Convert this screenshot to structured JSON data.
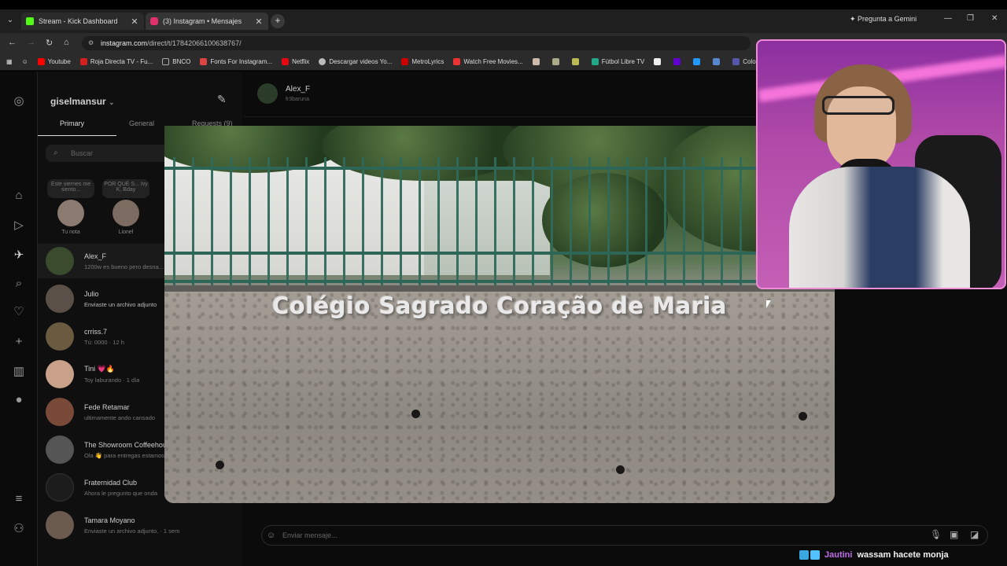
{
  "browser": {
    "tabs": [
      {
        "label": "Stream - Kick Dashboard",
        "color": "#53fc18"
      },
      {
        "label": "(3) Instagram • Mensajes",
        "color": "#e1306c"
      }
    ],
    "gemini": "Pregunta a Gemini",
    "url_host": "instagram.com",
    "url_path": "/direct/t/17842066100638767/",
    "bookmarks": [
      {
        "label": "Youtube",
        "color": "#ff0000"
      },
      {
        "label": "Roja Directa TV - Fu...",
        "color": "#d42020"
      },
      {
        "label": "BNCO",
        "color": "#888888"
      },
      {
        "label": "Fonts For Instagram...",
        "color": "#d44"
      },
      {
        "label": "Netflix",
        "color": "#e50914"
      },
      {
        "label": "Descargar videos Yo...",
        "color": "#bbb"
      },
      {
        "label": "MetroLyrics",
        "color": "#c00"
      },
      {
        "label": "Watch Free Movies...",
        "color": "#e33"
      },
      {
        "label": "Fútbol Libre TV",
        "color": "#2a8"
      },
      {
        "label": "Colossal",
        "color": "#55a"
      }
    ]
  },
  "instagram": {
    "username": "giselmansur",
    "tabs": [
      "Primary",
      "General",
      "Requests (9)"
    ],
    "search_placeholder": "Buscar",
    "notes": [
      {
        "bubble": "Este viernes me siento...",
        "name": "Tu nota"
      },
      {
        "bubble": "POR QUÉ S... Ivy K, Bday",
        "name": "Lionel"
      }
    ],
    "conversations": [
      {
        "name": "Alex_F",
        "preview": "1200w es bueno pero desna...",
        "color": "#3b4c2e"
      },
      {
        "name": "Julio",
        "preview": "Enviaste un archivo adjunto",
        "color": "#5a5048"
      },
      {
        "name": "crriss.7",
        "preview": "Tú: 0000 · 12 h",
        "color": "#6a5a40"
      },
      {
        "name": "Tini 💗🔥",
        "preview": "Toy laburando · 1 día",
        "color": "#c9a08a"
      },
      {
        "name": "Fede Retamar",
        "preview": "ultimamente ando cansado",
        "color": "#7a4a38"
      },
      {
        "name": "The Showroom Coffeehouse",
        "preview": "Ola 👋 para entregas estamos",
        "color": "#555"
      },
      {
        "name": "Fraternidad Club",
        "preview": "Ahora le pregunto que onda",
        "color": "#222"
      },
      {
        "name": "Tamara Moyano",
        "preview": "Enviaste un archivo adjunto. · 1 sem",
        "color": "#6b5a4e"
      }
    ],
    "chat": {
      "name": "Alex_F",
      "sub": "fr3baruna"
    },
    "message_placeholder": "Enviar mensaje..."
  },
  "photo": {
    "sign_text": "Colégio Sagrado Coração de Maria"
  },
  "stream_chat": {
    "user": "Jautini",
    "message": "wassam hacete monja"
  }
}
